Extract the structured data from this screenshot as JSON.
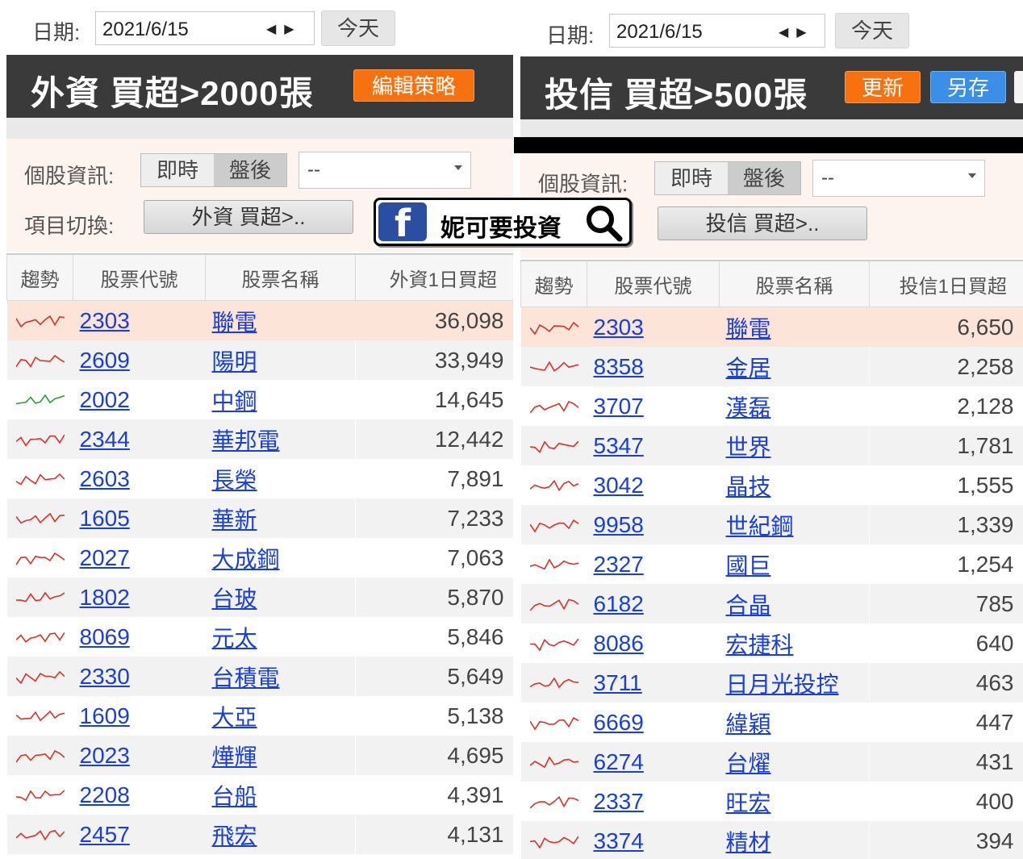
{
  "left": {
    "date_label": "日期:",
    "date_value": "2021/6/15",
    "today_label": "今天",
    "title": "外資 買超>2000張",
    "edit_strategy_label": "編輯策略",
    "info_label": "個股資訊:",
    "mode_realtime": "即時",
    "mode_after": "盤後",
    "select_value": "--",
    "switch_label": "項目切換:",
    "switch_value": "外資 買超>..",
    "headers": {
      "trend": "趨勢",
      "code": "股票代號",
      "name": "股票名稱",
      "value": "外資1日買超"
    },
    "rows": [
      {
        "code": "2303",
        "name": "聯電",
        "value": "36,098",
        "trend_color": "#d9322a"
      },
      {
        "code": "2609",
        "name": "陽明",
        "value": "33,949",
        "trend_color": "#d9322a"
      },
      {
        "code": "2002",
        "name": "中鋼",
        "value": "14,645",
        "trend_color": "#2e9a2e"
      },
      {
        "code": "2344",
        "name": "華邦電",
        "value": "12,442",
        "trend_color": "#d9322a"
      },
      {
        "code": "2603",
        "name": "長榮",
        "value": "7,891",
        "trend_color": "#d9322a"
      },
      {
        "code": "1605",
        "name": "華新",
        "value": "7,233",
        "trend_color": "#d9322a"
      },
      {
        "code": "2027",
        "name": "大成鋼",
        "value": "7,063",
        "trend_color": "#d9322a"
      },
      {
        "code": "1802",
        "name": "台玻",
        "value": "5,870",
        "trend_color": "#d9322a"
      },
      {
        "code": "8069",
        "name": "元太",
        "value": "5,846",
        "trend_color": "#d9322a"
      },
      {
        "code": "2330",
        "name": "台積電",
        "value": "5,649",
        "trend_color": "#d9322a"
      },
      {
        "code": "1609",
        "name": "大亞",
        "value": "5,138",
        "trend_color": "#d9322a"
      },
      {
        "code": "2023",
        "name": "燁輝",
        "value": "4,695",
        "trend_color": "#d9322a"
      },
      {
        "code": "2208",
        "name": "台船",
        "value": "4,391",
        "trend_color": "#d9322a"
      },
      {
        "code": "2457",
        "name": "飛宏",
        "value": "4,131",
        "trend_color": "#d9322a"
      }
    ]
  },
  "right": {
    "date_label": "日期:",
    "date_value": "2021/6/15",
    "today_label": "今天",
    "title": "投信 買超>500張",
    "update_label": "更新",
    "save_as_label": "另存",
    "info_label": "個股資訊:",
    "mode_realtime": "即時",
    "mode_after": "盤後",
    "select_value": "--",
    "switch_value": "投信 買超>..",
    "headers": {
      "trend": "趨勢",
      "code": "股票代號",
      "name": "股票名稱",
      "value": "投信1日買超"
    },
    "rows": [
      {
        "code": "2303",
        "name": "聯電",
        "value": "6,650",
        "trend_color": "#d9322a"
      },
      {
        "code": "8358",
        "name": "金居",
        "value": "2,258",
        "trend_color": "#d9322a"
      },
      {
        "code": "3707",
        "name": "漢磊",
        "value": "2,128",
        "trend_color": "#d9322a"
      },
      {
        "code": "5347",
        "name": "世界",
        "value": "1,781",
        "trend_color": "#d9322a"
      },
      {
        "code": "3042",
        "name": "晶技",
        "value": "1,555",
        "trend_color": "#d9322a"
      },
      {
        "code": "9958",
        "name": "世紀鋼",
        "value": "1,339",
        "trend_color": "#d9322a"
      },
      {
        "code": "2327",
        "name": "國巨",
        "value": "1,254",
        "trend_color": "#d9322a"
      },
      {
        "code": "6182",
        "name": "合晶",
        "value": "785",
        "trend_color": "#d9322a"
      },
      {
        "code": "8086",
        "name": "宏捷科",
        "value": "640",
        "trend_color": "#d9322a"
      },
      {
        "code": "3711",
        "name": "日月光投控",
        "value": "463",
        "trend_color": "#d9322a"
      },
      {
        "code": "6669",
        "name": "緯穎",
        "value": "447",
        "trend_color": "#d9322a"
      },
      {
        "code": "6274",
        "name": "台燿",
        "value": "431",
        "trend_color": "#d9322a"
      },
      {
        "code": "2337",
        "name": "旺宏",
        "value": "400",
        "trend_color": "#d9322a"
      },
      {
        "code": "3374",
        "name": "精材",
        "value": "394",
        "trend_color": "#d9322a"
      }
    ]
  },
  "badge": {
    "fb_letter": "f",
    "text": "妮可要投資",
    "icon": "search-icon"
  },
  "colors": {
    "title_bg": "#3a3a3a",
    "orange": "#f7720f",
    "blue": "#3b8fe6",
    "link": "#1a3fd8",
    "highlight_row": "#fde4d8"
  }
}
